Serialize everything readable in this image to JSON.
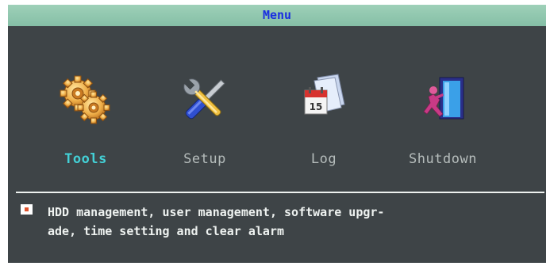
{
  "window": {
    "title": "Menu"
  },
  "menu": {
    "items": [
      {
        "label": "Tools",
        "icon": "gears-icon",
        "selected": true
      },
      {
        "label": "Setup",
        "icon": "wrench-screwdriver-icon",
        "selected": false
      },
      {
        "label": "Log",
        "icon": "calendar-log-icon",
        "selected": false
      },
      {
        "label": "Shutdown",
        "icon": "exit-door-icon",
        "selected": false
      }
    ]
  },
  "help": {
    "line1": "HDD management, user management, software upgr-",
    "line2": "ade, time setting and clear alarm"
  },
  "colors": {
    "title_bar": "#8fc7ae",
    "title_text": "#1a2ee0",
    "panel_background": "#3e4447",
    "selected_label": "#43d0d6",
    "label": "#b5bcbb"
  }
}
